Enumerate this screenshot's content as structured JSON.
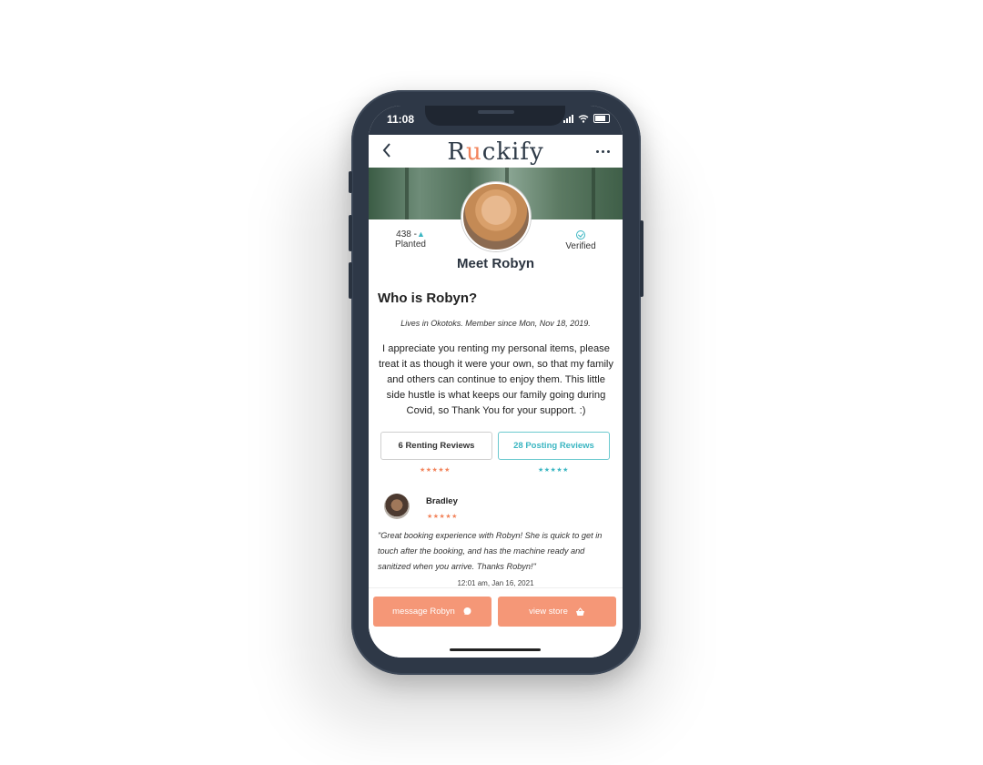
{
  "status": {
    "time": "11:08"
  },
  "header": {
    "logo_pre": "R",
    "logo_accent": "u",
    "logo_post": "ckify"
  },
  "profile": {
    "planted_count": "438 -",
    "planted_label": "Planted",
    "verified_label": "Verified",
    "name": "Meet Robyn"
  },
  "about": {
    "heading": "Who is Robyn?",
    "lives": "Lives in Okotoks. Member since Mon, Nov 18, 2019.",
    "bio": "I appreciate you renting my personal items, please treat it as though it were your own, so that my family and others can continue to enjoy them. This little side hustle is what keeps our family going during Covid, so Thank You for your support. :)"
  },
  "tabs": [
    {
      "label": "6 Renting Reviews",
      "stars": "★★★★★"
    },
    {
      "label": "28 Posting Reviews",
      "stars": "★★★★★"
    }
  ],
  "review": {
    "name": "Bradley",
    "stars": "★★★★★",
    "text": "\"Great booking experience with Robyn! She is quick to get in touch after the booking, and has the machine ready and sanitized when you arrive. Thanks Robyn!\"",
    "date": "12:01 am, Jan 16, 2021"
  },
  "actions": {
    "message": "message Robyn",
    "store": "view store"
  },
  "colors": {
    "accent": "#f2845c",
    "teal": "#3bb6c2",
    "frame": "#2e3847"
  }
}
